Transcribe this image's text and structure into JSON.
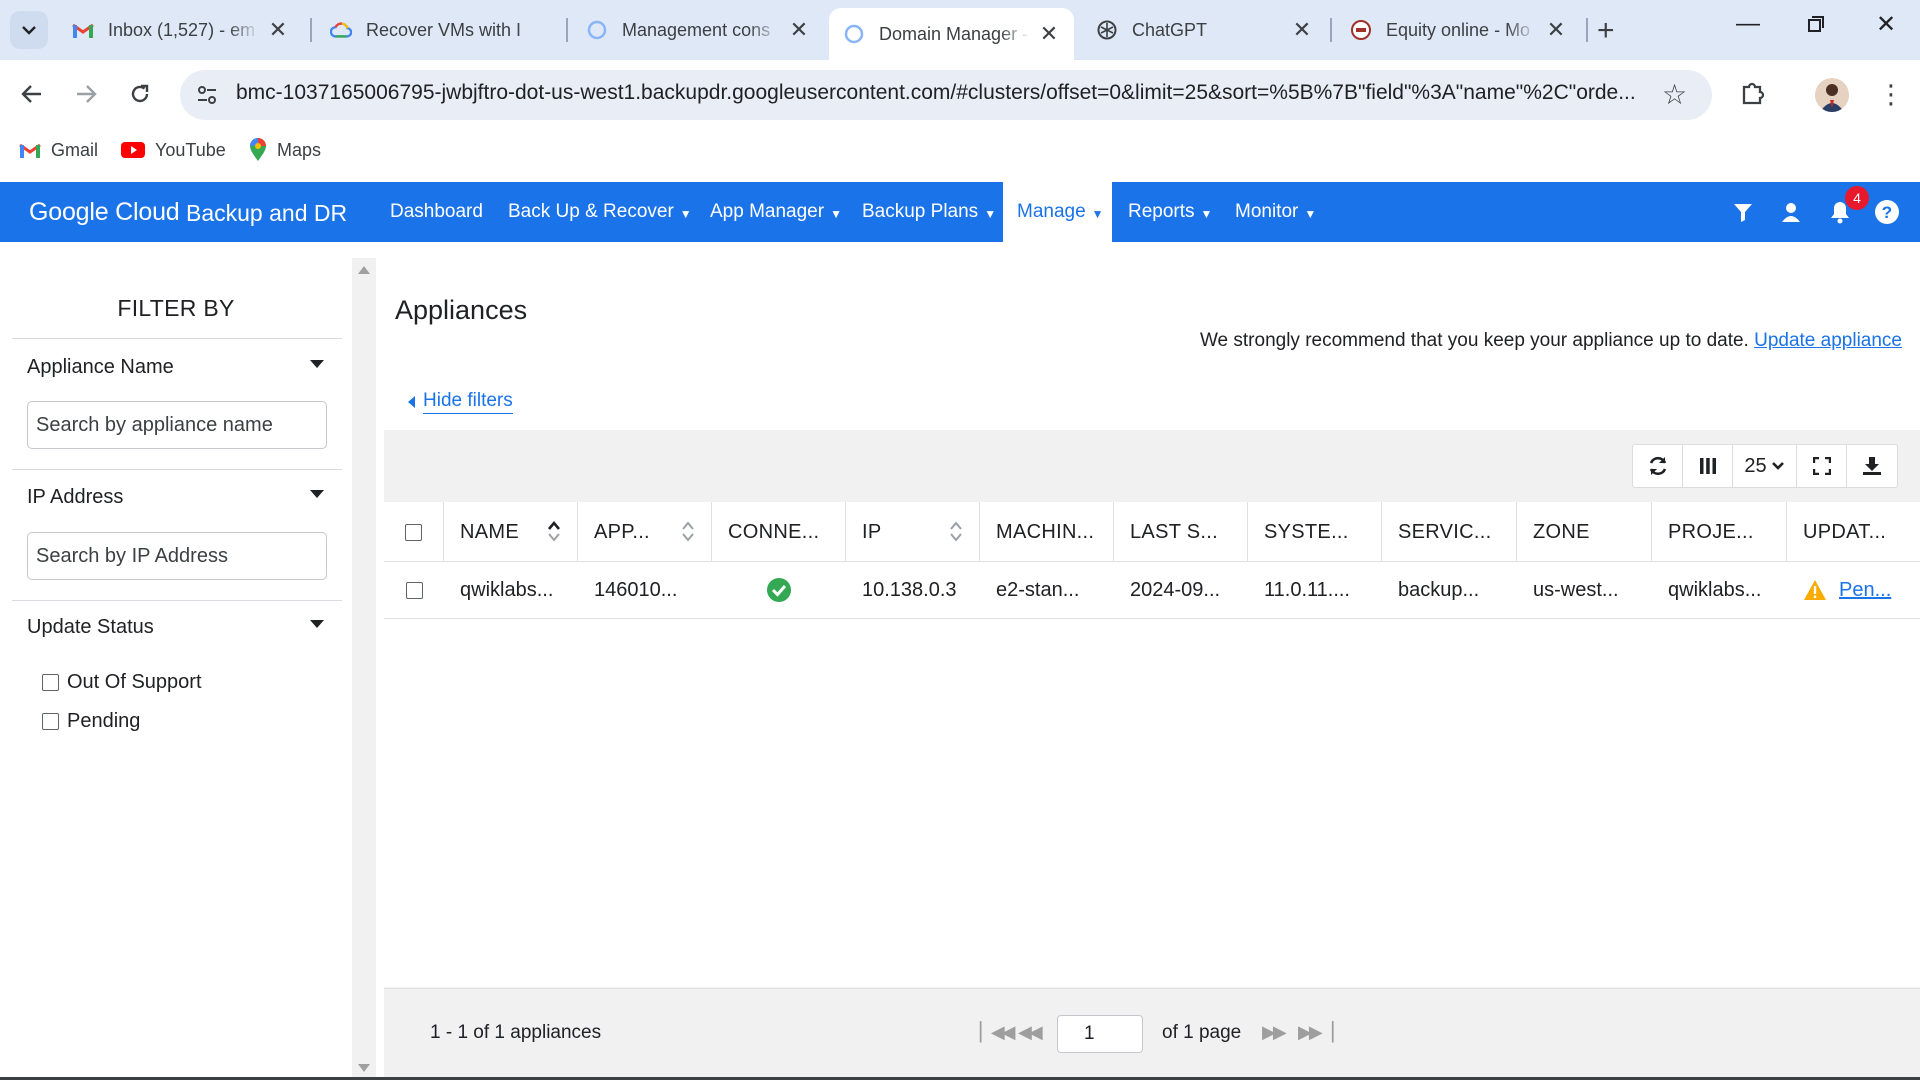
{
  "browser": {
    "tabs": [
      {
        "title": "Inbox (1,527) - em",
        "favicon": "gmail-icon"
      },
      {
        "title": "Recover VMs with I",
        "favicon": "google-cloud-icon"
      },
      {
        "title": "Management cons",
        "favicon": "loading-icon"
      },
      {
        "title": "Domain Manager -",
        "favicon": "loading-icon",
        "active": true
      },
      {
        "title": "ChatGPT",
        "favicon": "chatgpt-icon"
      },
      {
        "title": "Equity online - Mo",
        "favicon": "equity-icon"
      }
    ],
    "url": "bmc-1037165006795-jwbjftro-dot-us-west1.backupdr.googleusercontent.com/#clusters/offset=0&limit=25&sort=%5B%7B\"field\"%3A\"name\"%2C\"orde...",
    "bookmarks": [
      "Gmail",
      "YouTube",
      "Maps"
    ]
  },
  "app": {
    "brand_google": "Google Cloud",
    "brand_product": "Backup and DR",
    "nav": [
      "Dashboard",
      "Back Up & Recover",
      "App Manager",
      "Backup Plans",
      "Manage",
      "Reports",
      "Monitor"
    ],
    "active_nav": "Manage",
    "notifications_count": "4",
    "accent": "#1a73e8"
  },
  "sidebar": {
    "title": "FILTER BY",
    "appliance_name_label": "Appliance Name",
    "appliance_name_placeholder": "Search by appliance name",
    "ip_label": "IP Address",
    "ip_placeholder": "Search by IP Address",
    "update_status_label": "Update Status",
    "options": [
      "Out Of Support",
      "Pending"
    ]
  },
  "main": {
    "title": "Appliances",
    "recommend_text": "We strongly recommend that you keep your appliance up to date.",
    "update_link": "Update appliance",
    "hide_filters": "Hide filters",
    "page_size": "25",
    "columns": [
      "NAME",
      "APP...",
      "CONNE...",
      "IP",
      "MACHIN...",
      "LAST S...",
      "SYSTE...",
      "SERVIC...",
      "ZONE",
      "PROJE...",
      "UPDAT..."
    ],
    "rows": [
      {
        "name": "qwiklabs...",
        "app": "146010...",
        "connection": "connected",
        "ip": "10.138.0.3",
        "machine": "e2-stan...",
        "last": "2024-09...",
        "system": "11.0.11....",
        "service": "backup...",
        "zone": "us-west...",
        "project": "qwiklabs...",
        "update": "Pen..."
      }
    ],
    "count_text": "1 - 1 of 1 appliances",
    "page_value": "1",
    "of_pages": "of 1 page"
  }
}
